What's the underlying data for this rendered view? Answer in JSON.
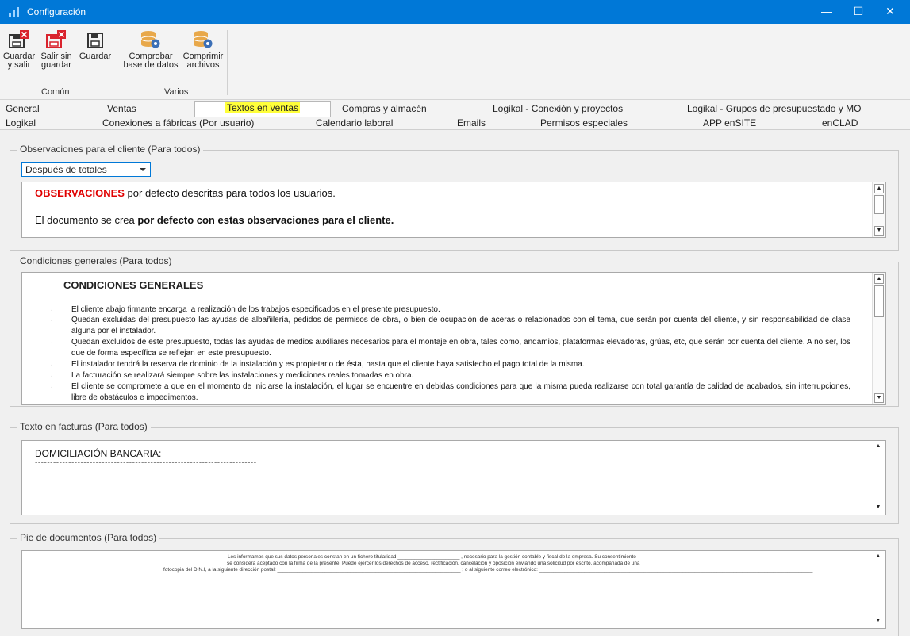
{
  "window": {
    "title": "Configuración",
    "minimize": "—",
    "maximize": "☐",
    "close": "✕"
  },
  "ribbon": {
    "buttons": {
      "save_exit": [
        "Guardar",
        "y salir"
      ],
      "exit_nosave": [
        "Salir sin",
        "guardar"
      ],
      "save": [
        "Guardar"
      ],
      "check_db": [
        "Comprobar",
        "base de datos"
      ],
      "compress": [
        "Comprimir",
        "archivos"
      ]
    },
    "groups": {
      "common": "Común",
      "various": "Varios"
    }
  },
  "tabs": {
    "row1": [
      "General",
      "Ventas",
      "Textos en ventas",
      "Compras y almacén",
      "Logikal - Conexión y proyectos",
      "Logikal - Grupos de presupuestado y MO"
    ],
    "row2": [
      "Logikal",
      "Conexiones a fábricas (Por usuario)",
      "Calendario laboral",
      "Emails",
      "Permisos especiales",
      "APP enSITE",
      "enCLAD"
    ],
    "active": "Textos en ventas"
  },
  "observaciones": {
    "title": "Observaciones para el cliente (Para todos)",
    "position_select": "Después de totales",
    "line1_red": "OBSERVACIONES",
    "line1_rest": " por defecto descritas para todos los usuarios.",
    "line2_normal": "El documento se crea ",
    "line2_bold": "por defecto con estas observaciones para el cliente."
  },
  "condiciones": {
    "title": "Condiciones generales (Para todos)",
    "heading": "CONDICIONES GENERALES",
    "bullet": ".",
    "items": [
      "El cliente abajo firmante encarga la realización de los trabajos especificados en el presente presupuesto.",
      "Quedan excluidas del presupuesto las ayudas de albañilería, pedidos de permisos de obra, o bien de ocupación de aceras o relacionados con el tema, que serán por cuenta del cliente, y sin responsabilidad de clase alguna por el instalador.",
      "Quedan excluidos de este presupuesto, todas las ayudas de medios auxiliares necesarios para el montaje en obra, tales como, andamios, plataformas elevadoras, grúas, etc, que serán por cuenta del cliente. A no ser, los que de forma específica se reflejan en este presupuesto.",
      "El instalador tendrá la reserva de dominio de la instalación y es propietario de ésta, hasta que el cliente haya satisfecho el pago total de la misma.",
      "La facturación se realizará siempre sobre las instalaciones y mediciones reales tomadas en obra.",
      "El cliente se compromete a que en el momento de iniciarse la instalación, el lugar se encuentre en debidas condiciones para que la misma pueda realizarse con total garantía de calidad de acabados, sin interrupciones, libre de obstáculos e impedimentos."
    ]
  },
  "facturas": {
    "title": "Texto en facturas (Para todos)",
    "line1": "DOMICILIACIÓN BANCARIA:",
    "line2": "-------------------------------------------------------------------------"
  },
  "pie": {
    "title": "Pie de documentos (Para todos)",
    "line1": "Les informamos que sus datos personales constan en un fichero titularidad ______________________ , necesario para la gestión contable y fiscal de la empresa. Su consentimiento",
    "line2": "se considera aceptado con la firma de la presente. Puede ejercer los derechos de acceso, rectificación, cancelación y oposición enviando una solicitud por escrito, acompañada de una",
    "line3": "fotocopia del D.N.I, a la siguiente dirección postal: _________________________________________________________________ ; o al siguiente correo electrónico: _________________________________________________________________________________________________"
  },
  "colors": {
    "titlebar": "#0078d7",
    "highlight": "#ffff3a",
    "red_text": "#e00000",
    "save_exit_accent": "#d9232d"
  }
}
